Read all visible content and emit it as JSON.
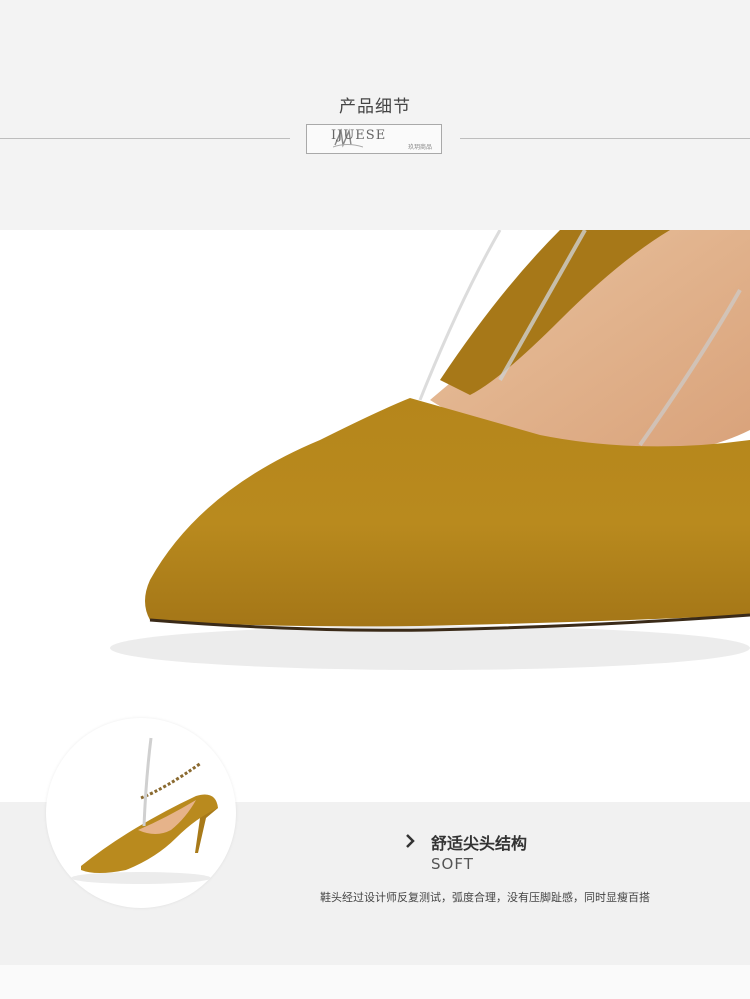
{
  "header": {
    "section_title": "产品细节",
    "brand_name": "IJUESE",
    "brand_subtitle": "玖玥商品"
  },
  "photo": {
    "shoe_color": "#b98a1d",
    "shadow_color": "#e9e9e9"
  },
  "feature": {
    "title": "舒适尖头结构",
    "subtitle": "SOFT",
    "description": "鞋头经过设计师反复测试，弧度合理，没有压脚趾感，同时显瘦百搭"
  },
  "icons": {
    "chevron": "chevron-right-icon"
  }
}
